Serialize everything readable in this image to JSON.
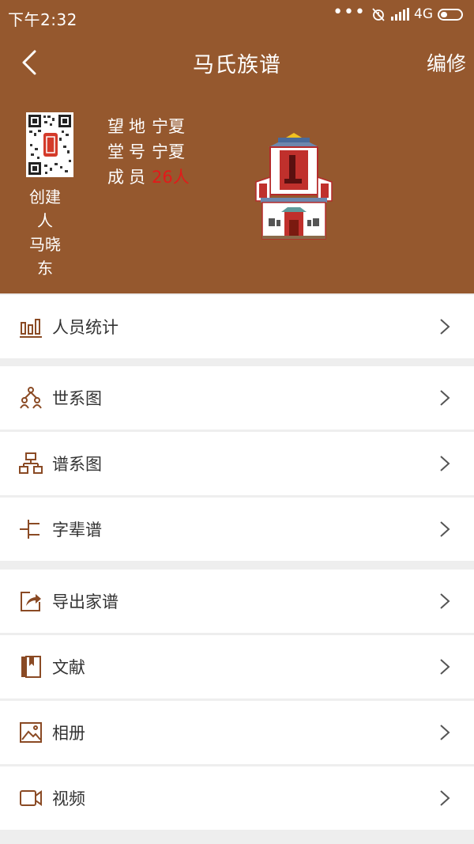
{
  "status": {
    "time": "下午2:32",
    "network": "4G"
  },
  "nav": {
    "title": "马氏族谱",
    "edit_label": "编修"
  },
  "creator": {
    "label_lines": [
      "创建",
      "人",
      "马晓",
      "东"
    ]
  },
  "info": {
    "rows": [
      {
        "key": "望地",
        "value": "宁夏"
      },
      {
        "key": "堂号",
        "value": "宁夏"
      },
      {
        "key": "成员",
        "value": "26人"
      }
    ]
  },
  "menu": {
    "items": [
      {
        "label": "人员统计",
        "icon": "bar-chart-icon"
      },
      {
        "label": "世系图",
        "icon": "people-tree-icon"
      },
      {
        "label": "谱系图",
        "icon": "org-chart-icon"
      },
      {
        "label": "字辈谱",
        "icon": "branch-lines-icon"
      },
      {
        "label": "导出家谱",
        "icon": "export-icon"
      },
      {
        "label": "文献",
        "icon": "book-icon"
      },
      {
        "label": "相册",
        "icon": "image-icon"
      },
      {
        "label": "视频",
        "icon": "video-icon"
      }
    ]
  },
  "colors": {
    "header_bg": "#95582e",
    "accent_icon": "#8a4a24",
    "highlight_red": "#e21a1a"
  }
}
